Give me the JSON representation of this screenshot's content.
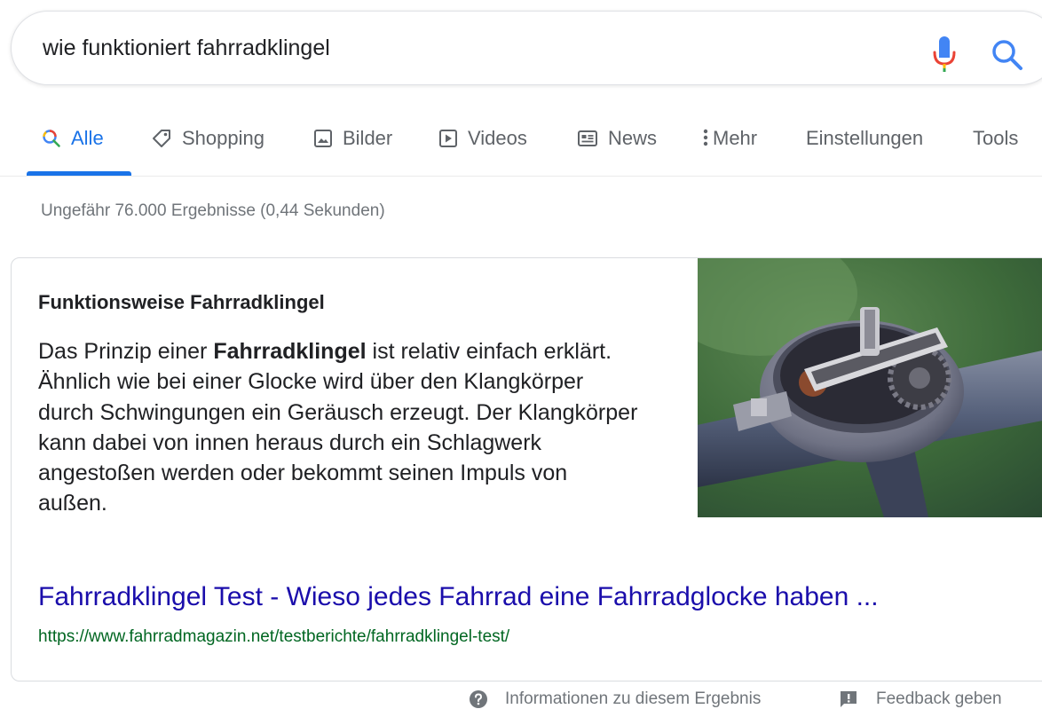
{
  "search": {
    "query": "wie funktioniert fahrradklingel",
    "mic_icon": "microphone-icon",
    "search_icon": "magnifier-icon"
  },
  "tabs": [
    {
      "label": "Alle",
      "icon": "search-icon",
      "active": true
    },
    {
      "label": "Shopping",
      "icon": "tag-icon"
    },
    {
      "label": "Bilder",
      "icon": "image-icon"
    },
    {
      "label": "Videos",
      "icon": "play-icon"
    },
    {
      "label": "News",
      "icon": "newspaper-icon"
    },
    {
      "label": "Mehr",
      "icon": "more-vert-icon"
    },
    {
      "label": "Einstellungen"
    },
    {
      "label": "Tools"
    }
  ],
  "results": {
    "stats": "Ungefähr 76.000 Ergebnisse (0,44 Sekunden)"
  },
  "snippet": {
    "heading": "Funktionsweise Fahrradklingel",
    "text_before": "Das Prinzip einer ",
    "text_bold": "Fahrradklingel",
    "text_after": " ist relativ einfach erklärt. Ähnlich wie bei einer Glocke wird über den Klangkörper durch Schwingungen ein Geräusch erzeugt. Der Klangkörper kann dabei von innen heraus durch ein Schlagwerk angestoßen werden oder bekommt seinen Impuls von außen.",
    "image": "bicycle-bell-photo",
    "result_title": "Fahrradklingel Test - Wieso jedes Fahrrad eine Fahrradglocke haben ...",
    "result_url": "https://www.fahrradmagazin.net/testberichte/fahrradklingel-test/"
  },
  "footer": {
    "info_label": "Informationen zu diesem Ergebnis",
    "feedback_label": "Feedback geben"
  },
  "colors": {
    "accent": "#1a73e8",
    "link": "#1a0dab",
    "url": "#006621",
    "muted": "#70757a"
  }
}
